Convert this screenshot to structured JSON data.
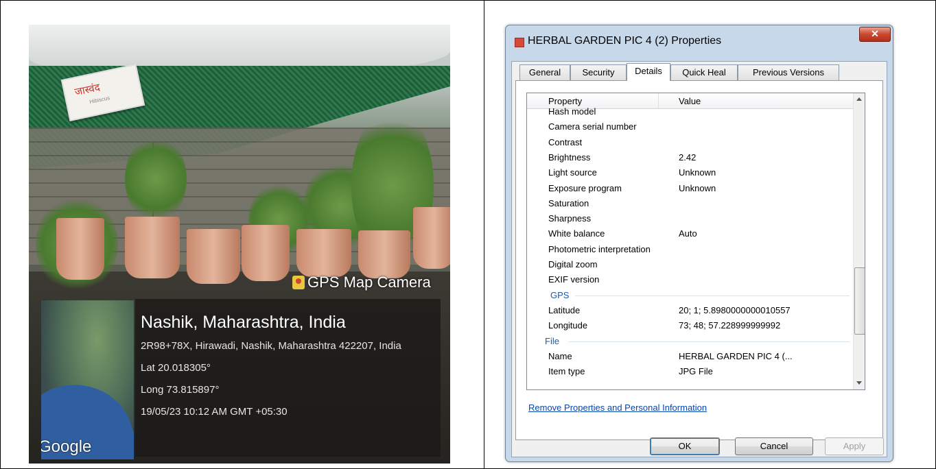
{
  "photo": {
    "sign_text": "जास्वंद",
    "sign_subtext": "Hibiscus",
    "gps_label": "GPS Map Camera",
    "location_title": "Nashik, Maharashtra, India",
    "address": "2R98+78X, Hirawadi, Nashik, Maharashtra 422207, India",
    "lat": "Lat 20.018305°",
    "long": "Long 73.815897°",
    "datetime": "19/05/23 10:12 AM GMT +05:30",
    "map_brand": "Google"
  },
  "dialog": {
    "title": "HERBAL GARDEN PIC 4 (2) Properties",
    "close_label": "✕",
    "tabs": [
      "General",
      "Security",
      "Details",
      "Quick Heal",
      "Previous Versions"
    ],
    "active_tab": "Details",
    "columns": {
      "property": "Property",
      "value": "Value"
    },
    "rows": [
      {
        "k": "Hash model",
        "v": ""
      },
      {
        "k": "Camera serial number",
        "v": ""
      },
      {
        "k": "Contrast",
        "v": ""
      },
      {
        "k": "Brightness",
        "v": "2.42"
      },
      {
        "k": "Light source",
        "v": "Unknown"
      },
      {
        "k": "Exposure program",
        "v": "Unknown"
      },
      {
        "k": "Saturation",
        "v": ""
      },
      {
        "k": "Sharpness",
        "v": ""
      },
      {
        "k": "White balance",
        "v": "Auto"
      },
      {
        "k": "Photometric interpretation",
        "v": ""
      },
      {
        "k": "Digital zoom",
        "v": ""
      },
      {
        "k": "EXIF version",
        "v": ""
      },
      {
        "group": "GPS"
      },
      {
        "k": "Latitude",
        "v": "20; 1; 5.8980000000010557"
      },
      {
        "k": "Longitude",
        "v": "73; 48; 57.228999999992"
      },
      {
        "group": "File"
      },
      {
        "k": "Name",
        "v": "HERBAL GARDEN PIC 4 (..."
      },
      {
        "k": "Item type",
        "v": "JPG File"
      }
    ],
    "remove_link": "Remove Properties and Personal Information",
    "ok_label": "OK",
    "cancel_label": "Cancel",
    "apply_label": "Apply"
  }
}
